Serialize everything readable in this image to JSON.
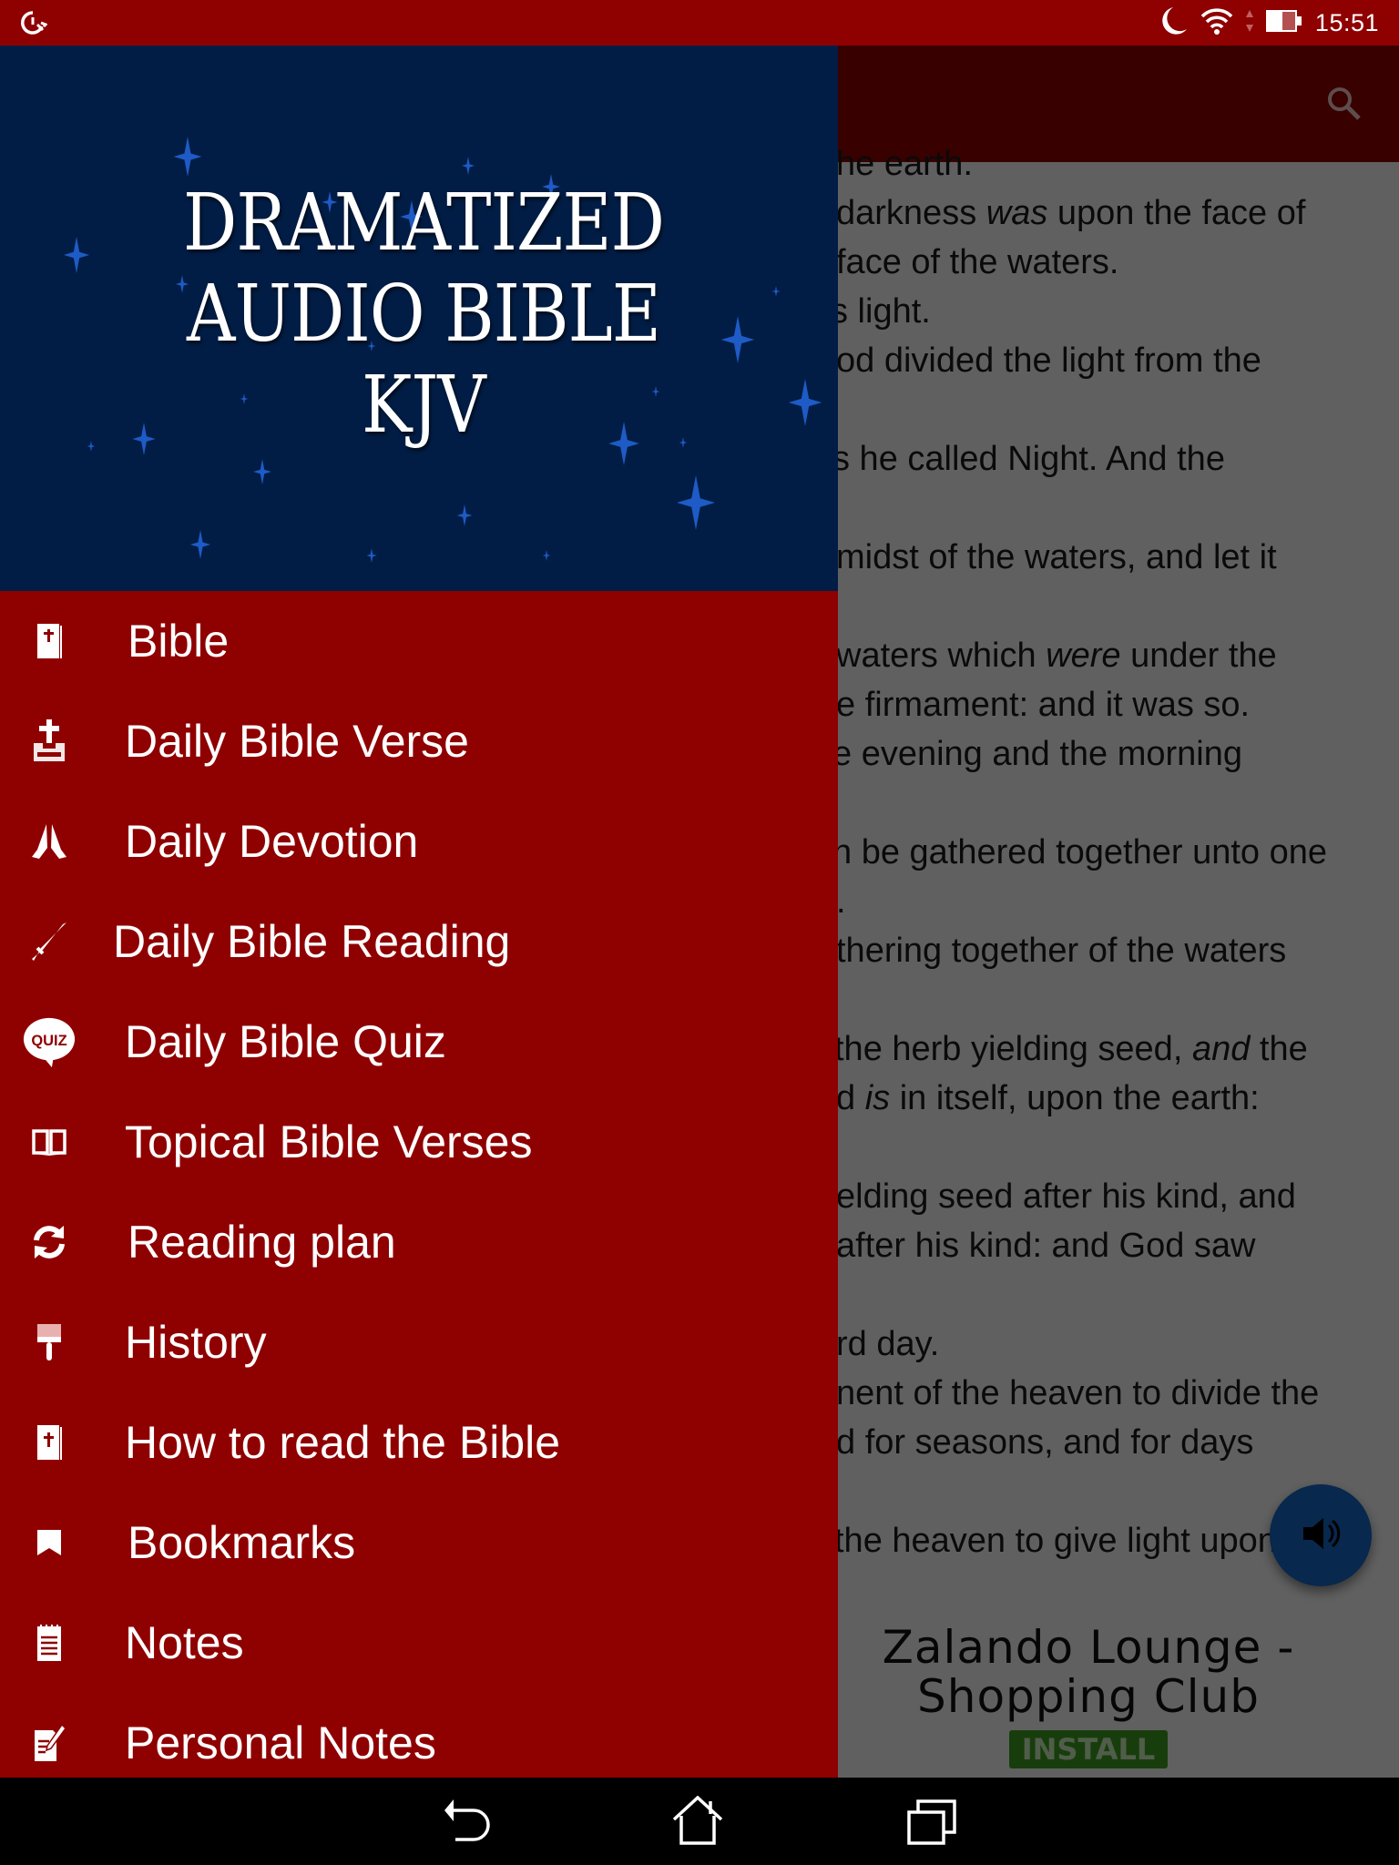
{
  "status_bar": {
    "left_icon": "speed-wrench-icon",
    "icons": [
      "moon-icon",
      "wifi-icon",
      "data-arrows-icon",
      "battery-icon"
    ],
    "time": "15:51"
  },
  "toolbar": {
    "search_icon": "search-icon"
  },
  "content": {
    "verse_lines": [
      {
        "pre": "he earth.",
        "it": "",
        "post": ""
      },
      {
        "pre": " darkness ",
        "it": "was",
        "post": " upon the face of"
      },
      {
        "pre": " face of the waters.",
        "it": "",
        "post": ""
      },
      {
        "pre": "s light.",
        "it": "",
        "post": ""
      },
      {
        "pre": "od divided the light from the",
        "it": "",
        "post": ""
      },
      {
        "pre": "s he called Night. And the",
        "it": "",
        "post": ""
      },
      {
        "pre": "midst of the waters, and let it",
        "it": "",
        "post": ""
      },
      {
        "pre": " waters which ",
        "it": "were",
        "post": " under the"
      },
      {
        "pre": "e firmament: and it was so.",
        "it": "",
        "post": ""
      },
      {
        "pre": "e evening and the morning",
        "it": "",
        "post": ""
      },
      {
        "pre": "n be gathered together unto one",
        "it": "",
        "post": ""
      },
      {
        "pre": ".",
        "it": "",
        "post": ""
      },
      {
        "pre": "thering together of the waters",
        "it": "",
        "post": ""
      },
      {
        "pre": " the herb yielding seed, ",
        "it": "and",
        "post": " the"
      },
      {
        "pre": "d ",
        "it": "is",
        "post": " in itself, upon the earth:"
      },
      {
        "pre": "elding seed after his kind, and",
        "it": "",
        "post": ""
      },
      {
        "pre": "after his kind: and God saw",
        "it": "",
        "post": ""
      },
      {
        "pre": "rd day.",
        "it": "",
        "post": ""
      },
      {
        "pre": "nent of the heaven to divide the",
        "it": "",
        "post": ""
      },
      {
        "pre": "d for seasons, and for days",
        "it": "",
        "post": ""
      },
      {
        "pre": " the heaven to give light upon",
        "it": "",
        "post": ""
      }
    ]
  },
  "ad": {
    "title": "Zalando Lounge - Shopping Club",
    "install_label": "INSTALL"
  },
  "fab": {
    "icon": "volume-icon"
  },
  "drawer": {
    "header": {
      "title_lines": [
        "DRAMATIZED",
        "AUDIO BIBLE",
        "KJV"
      ]
    },
    "items": [
      {
        "label": "Bible",
        "icon": "bible-icon"
      },
      {
        "label": "Daily Bible Verse",
        "icon": "bible-cross-icon"
      },
      {
        "label": "Daily Devotion",
        "icon": "praying-hands-icon"
      },
      {
        "label": "Daily Bible Reading",
        "icon": "quill-icon"
      },
      {
        "label": "Daily Bible Quiz",
        "icon": "quiz-bubble-icon",
        "badge": "QUIZ"
      },
      {
        "label": "Topical Bible Verses",
        "icon": "open-book-icon"
      },
      {
        "label": "Reading plan",
        "icon": "refresh-icon"
      },
      {
        "label": "History",
        "icon": "paint-brush-icon"
      },
      {
        "label": "How to read the Bible",
        "icon": "bible-icon"
      },
      {
        "label": "Bookmarks",
        "icon": "bookmark-icon"
      },
      {
        "label": "Notes",
        "icon": "notepad-icon"
      },
      {
        "label": "Personal Notes",
        "icon": "edit-note-icon"
      }
    ]
  },
  "nav_bar": {
    "buttons": [
      "back-icon",
      "home-icon",
      "recents-icon"
    ]
  },
  "colors": {
    "primary": "#8f0000",
    "header_bg": "#021d45",
    "fab": "#1565c0",
    "install": "#3d9a1f"
  }
}
